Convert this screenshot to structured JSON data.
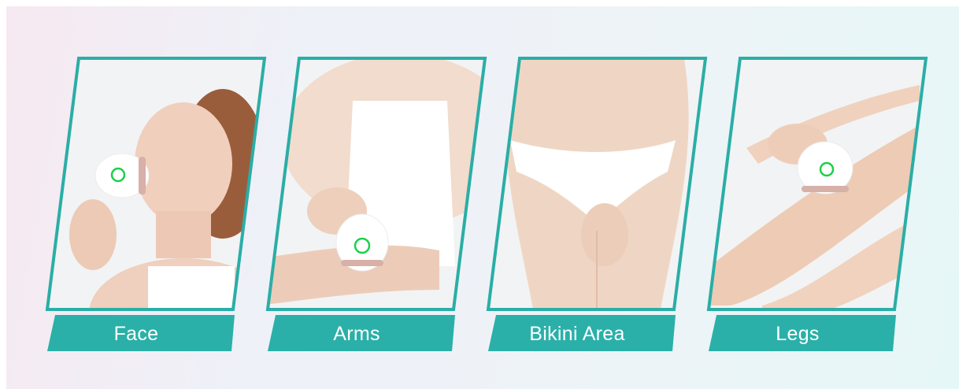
{
  "cards": [
    {
      "label": "Face",
      "photo_tone": "#efd6c6"
    },
    {
      "label": "Arms",
      "photo_tone": "#f2dfd2"
    },
    {
      "label": "Bikini Area",
      "photo_tone": "#efdbc9"
    },
    {
      "label": "Legs",
      "photo_tone": "#f3d9c6"
    }
  ],
  "colors": {
    "frame": "#2aaea6",
    "label_bar": "#2ab0a9",
    "label_text": "#ffffff",
    "device_body": "#ffffff",
    "device_ring": "#d7b0a8",
    "device_led": "#19d14a",
    "background_left": "#f6e9f1",
    "background_right": "#e6f7f7"
  },
  "icons": [
    "epilator-device-icon"
  ]
}
